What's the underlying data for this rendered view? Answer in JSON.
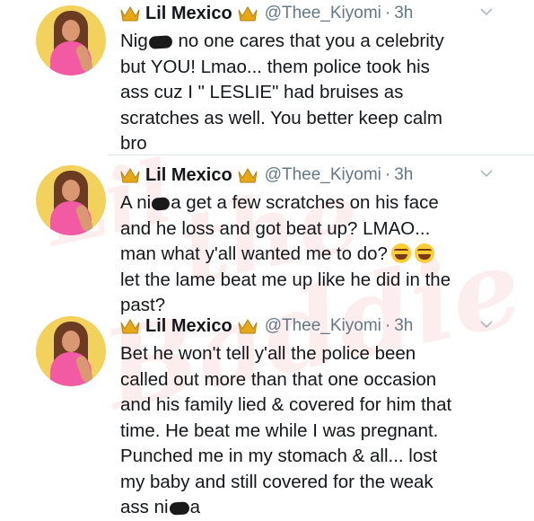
{
  "watermark": {
    "lines": [
      "Lil",
      "the",
      "Baddie"
    ]
  },
  "tweets": [
    {
      "name": "Lil Mexico",
      "handle": "@Thee_Kiyomi",
      "separator": "·",
      "time": "3h",
      "text_parts": [
        "Nig",
        "no one cares that you a celebrity\nbut YOU! Lmao... them police took his\nass cuz I \" LESLIE\" had bruises as\nscratches as well. You better keep calm\nbro"
      ]
    },
    {
      "name": "Lil Mexico",
      "handle": "@Thee_Kiyomi",
      "separator": "·",
      "time": "3h",
      "text_parts": [
        "A ni",
        "a get a few scratches on his face\nand he loss and got beat up? LMAO...\nman what y'all wanted me to do?",
        "\nlet the lame beat me up like he did in the\npast?"
      ]
    },
    {
      "name": "Lil Mexico",
      "handle": "@Thee_Kiyomi",
      "separator": "·",
      "time": "3h",
      "text_parts": [
        "Bet he won't tell y'all the police been\ncalled out more than that one occasion\nand his family lied & covered for him that\ntime. He beat me while I was pregnant.\nPunched me in my stomach & all... lost\nmy baby and still covered for the weak\nass ni",
        "a"
      ]
    }
  ],
  "colors": {
    "name": "#14171a",
    "meta": "#657786",
    "crown": "#e6a817",
    "watermark": "#e94a58"
  },
  "icons": [
    "crown-icon",
    "chevron-down-icon",
    "tears-of-joy-emoji"
  ]
}
